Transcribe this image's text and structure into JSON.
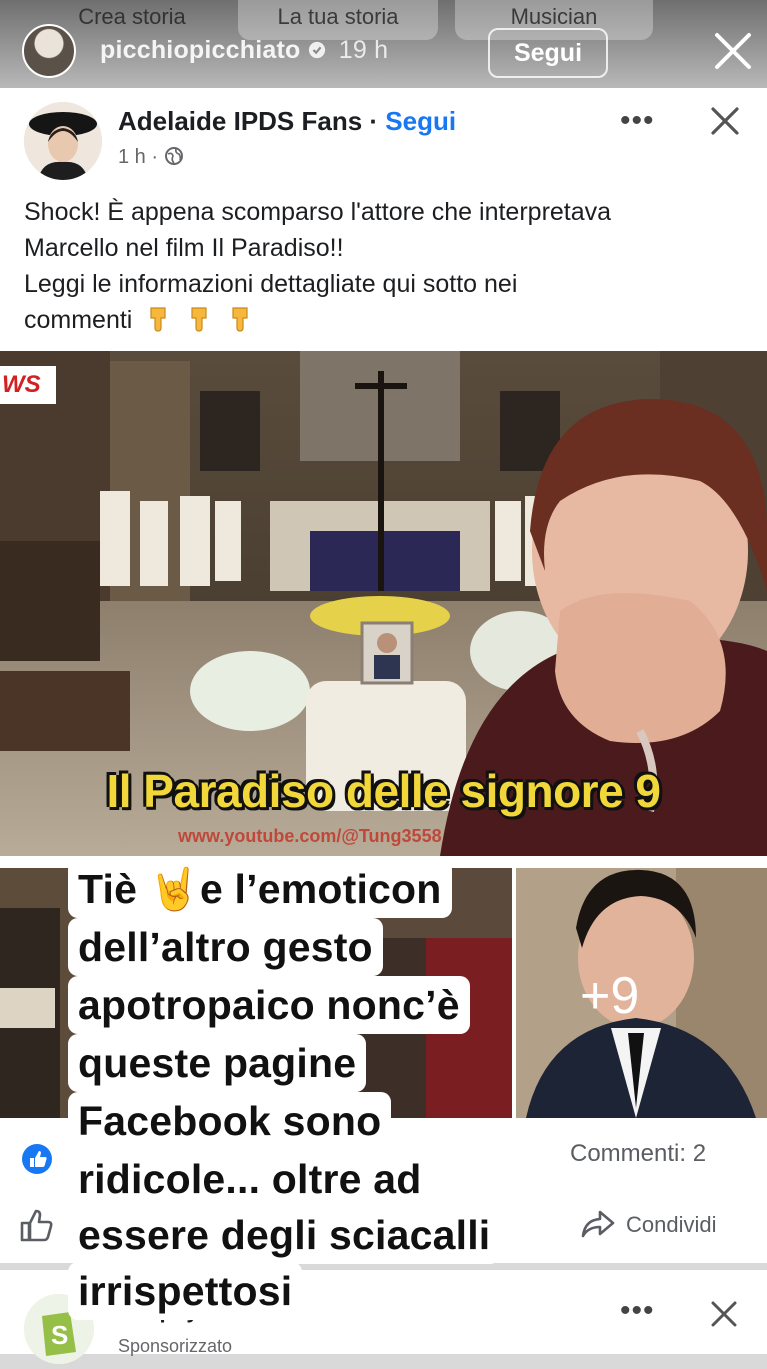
{
  "story": {
    "tabs": [
      "Crea storia",
      "La tua storia",
      "Musician"
    ],
    "username": "picchiopicchiato",
    "time": "19 h",
    "follow_label": "Segui"
  },
  "post": {
    "page_name": "Adelaide IPDS Fans",
    "separator": " · ",
    "follow_label": "Segui",
    "time": "1 h",
    "meta_dot": " · ",
    "more_label": "•••",
    "text_lines": [
      "Shock! È appena scomparso l'attore che interpretava",
      "Marcello nel film Il Paradiso!!",
      "Leggi le informazioni dettagliate qui sotto nei",
      "commenti"
    ],
    "image_badge": "WS",
    "image_caption": "Il Paradiso delle signore 9",
    "image_url": "www.youtube.com/@Tung3558",
    "more_photos": "+9",
    "comments": "Commenti: 2",
    "share_label": "Condividi"
  },
  "sticker": {
    "lines": [
      "Tiè 🤘e l’emoticon",
      "dell’altro gesto",
      "apotropaico nonc’è",
      "queste pagine",
      "Facebook sono",
      "ridicole... oltre ad",
      "essere degli sciacalli",
      "irrispettosi"
    ]
  },
  "next_post": {
    "name": "Shopify",
    "sub": "Sponsorizzato",
    "more_label": "•••"
  },
  "colors": {
    "facebook_blue": "#1877f2",
    "caption_yellow": "#f2d73b"
  }
}
